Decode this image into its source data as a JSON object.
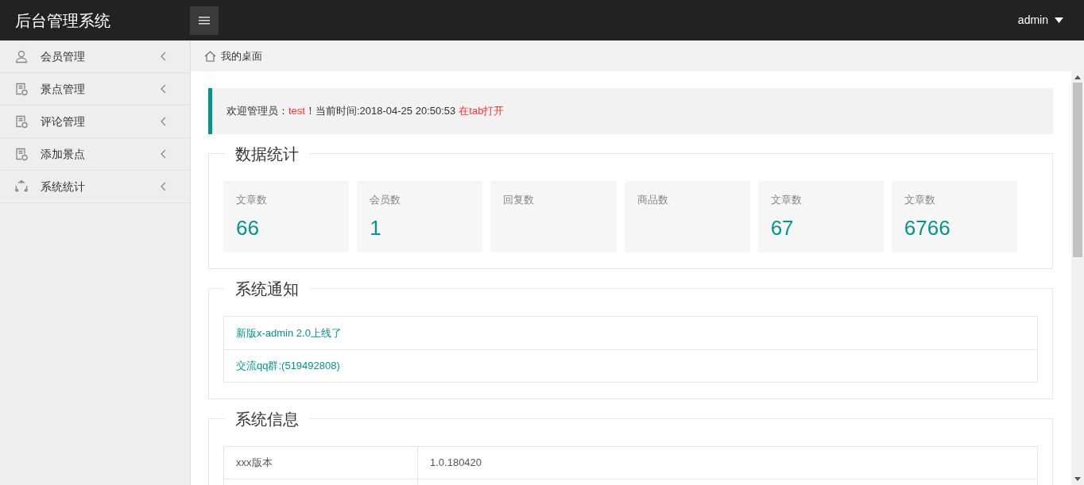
{
  "header": {
    "title": "后台管理系统",
    "user": "admin"
  },
  "sidebar": {
    "items": [
      {
        "label": "会员管理",
        "kind": "user"
      },
      {
        "label": "景点管理",
        "kind": "doc"
      },
      {
        "label": "评论管理",
        "kind": "doc"
      },
      {
        "label": "添加景点",
        "kind": "doc"
      },
      {
        "label": "系统统计",
        "kind": "cycle"
      }
    ]
  },
  "breadcrumb": "我的桌面",
  "welcome": {
    "prefix": "欢迎管理员：",
    "name": "test",
    "middle": "！当前时间:2018-04-25 20:50:53",
    "link": "在tab打开"
  },
  "stats": {
    "title": "数据统计",
    "cards": [
      {
        "label": "文章数",
        "value": "66"
      },
      {
        "label": "会员数",
        "value": "1"
      },
      {
        "label": "回复数"
      },
      {
        "label": "商品数"
      },
      {
        "label": "文章数",
        "value": "67"
      },
      {
        "label": "文章数",
        "value": "6766"
      }
    ]
  },
  "notices": {
    "title": "系统通知",
    "items": [
      "新版x-admin 2.0上线了",
      "交流qq群:(519492808)"
    ]
  },
  "info": {
    "title": "系统信息",
    "rows": [
      {
        "name": "xxx版本",
        "value": "1.0.180420"
      }
    ]
  }
}
